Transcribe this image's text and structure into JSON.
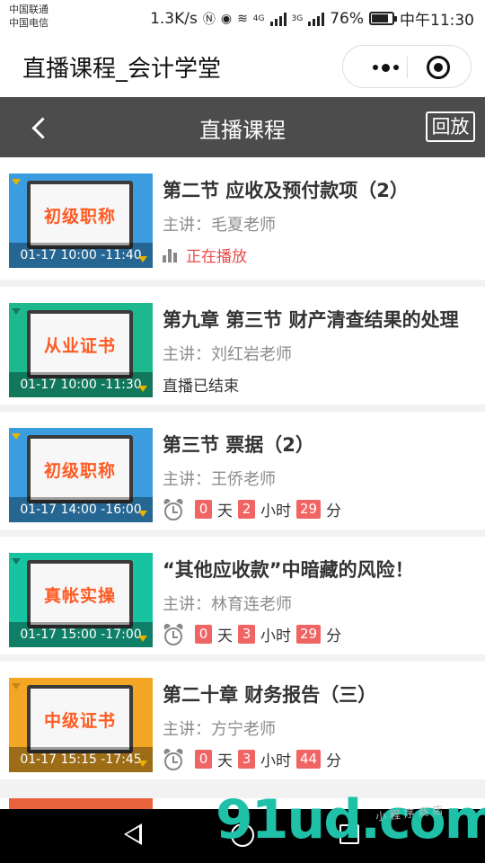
{
  "status_bar": {
    "carrier_1": "中国联通",
    "carrier_2": "中国电信",
    "speed": "1.3K/s",
    "network_4g": "4G",
    "network_3g": "3G",
    "battery": "76%",
    "time": "中午11:30"
  },
  "app": {
    "title": "直播课程_会计学堂"
  },
  "nav": {
    "title": "直播课程",
    "replay_label": "回放"
  },
  "courses": [
    {
      "thumb_label": "初级职称",
      "thumb_color": "#3b9de0",
      "thumb_text_color": "#ff5a22",
      "time": "01-17 10:00 -11:40",
      "title": "第二节 应收及预付款项（2）",
      "teacher": "主讲：毛夏老师",
      "status": "正在播放"
    },
    {
      "thumb_label": "从业证书",
      "thumb_color": "#1db88e",
      "thumb_text_color": "#ff5a22",
      "time": "01-17 10:00 -11:30",
      "title": "第九章 第三节 财产清查结果的处理",
      "teacher": "主讲：刘红岩老师",
      "status": "直播已结束"
    },
    {
      "thumb_label": "初级职称",
      "thumb_color": "#3b9de0",
      "thumb_text_color": "#ff5a22",
      "time": "01-17 14:00 -16:00",
      "title": "第三节 票据（2）",
      "teacher": "主讲：王侨老师",
      "countdown": {
        "days": "0",
        "day_unit": "天",
        "hours": "2",
        "hour_unit": "小时",
        "minutes": "29",
        "minute_unit": "分"
      }
    },
    {
      "thumb_label": "真帐实操",
      "thumb_color": "#17c3a0",
      "thumb_text_color": "#ff5a22",
      "time": "01-17 15:00 -17:00",
      "title": "“其他应收款”中暗藏的风险！",
      "teacher": "主讲：林育连老师",
      "countdown": {
        "days": "0",
        "day_unit": "天",
        "hours": "3",
        "hour_unit": "小时",
        "minutes": "29",
        "minute_unit": "分"
      }
    },
    {
      "thumb_label": "中级证书",
      "thumb_color": "#f2a623",
      "thumb_text_color": "#ff5a22",
      "time": "01-17 15:15 -17:45",
      "title": "第二十章 财务报告（三）",
      "teacher": "主讲：方宁老师",
      "countdown": {
        "days": "0",
        "day_unit": "天",
        "hours": "3",
        "hour_unit": "小时",
        "minutes": "44",
        "minute_unit": "分"
      }
    }
  ],
  "watermark": {
    "main": "91ud.com",
    "sub": "小 程 序 商 店"
  }
}
